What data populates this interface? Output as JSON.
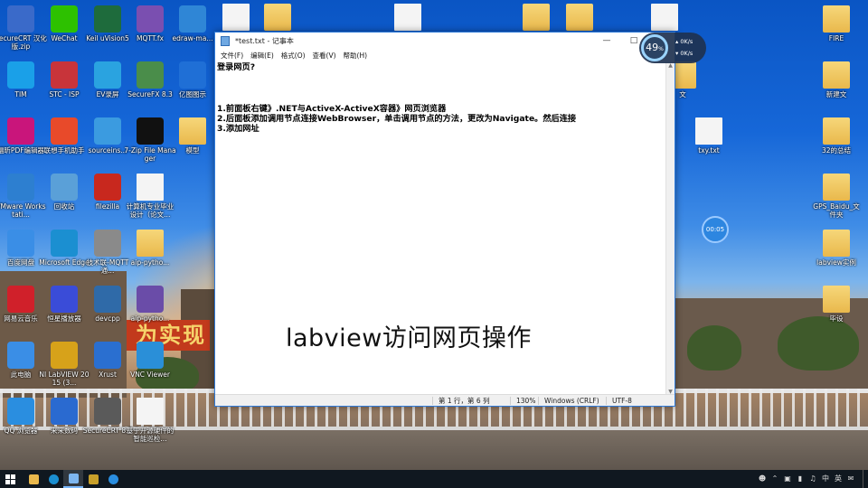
{
  "desktop": {
    "icons_left": [
      {
        "id": "securecrt-zip",
        "label": "SecureCRT 汉化版.zip",
        "icon": "winrar-archive-icon",
        "color": "#3a6ac9"
      },
      {
        "id": "wechat",
        "label": "WeChat",
        "icon": "wechat-icon",
        "color": "#2dc100"
      },
      {
        "id": "keil",
        "label": "Keil uVision5",
        "icon": "keil-icon",
        "color": "#1e6b3c"
      },
      {
        "id": "mqttfx",
        "label": "MQTT.fx",
        "icon": "mqttfx-icon",
        "color": "#7a4fb0"
      },
      {
        "id": "edraw",
        "label": "edraw-ma...",
        "icon": "edraw-icon",
        "color": "#2f86d6"
      },
      {
        "id": "tim",
        "label": "TIM",
        "icon": "tim-icon",
        "color": "#1aa0e8"
      },
      {
        "id": "stc-isp",
        "label": "STC - ISP",
        "icon": "stc-isp-icon",
        "color": "#c8343a"
      },
      {
        "id": "ev-record",
        "label": "EV录屏",
        "icon": "ev-record-icon",
        "color": "#2aa3e0"
      },
      {
        "id": "securefx",
        "label": "SecureFX 8.3",
        "icon": "securefx-icon",
        "color": "#4a8d4a"
      },
      {
        "id": "yitu",
        "label": "亿图图示",
        "icon": "yitu-icon",
        "color": "#1f6fd6"
      },
      {
        "id": "pdf-reader",
        "label": "福昕PDF编辑器",
        "icon": "pdf-icon",
        "color": "#c9157b"
      },
      {
        "id": "phone-assistant",
        "label": "联想手机助手",
        "icon": "phone-assistant-icon",
        "color": "#e84a2a"
      },
      {
        "id": "sourceinsight",
        "label": "sourceins...",
        "icon": "sourceinsight-icon",
        "color": "#3b9be0"
      },
      {
        "id": "7zip",
        "label": "7-Zip File Manager",
        "icon": "7zip-icon",
        "color": "#111111"
      },
      {
        "id": "folder-model",
        "label": "模型",
        "icon": "folder-icon",
        "color": "#e9b84c"
      },
      {
        "id": "vmware",
        "label": "VMware Workstati...",
        "icon": "vmware-icon",
        "color": "#2d7fd0"
      },
      {
        "id": "recycle-bin",
        "label": "回收站",
        "icon": "recycle-bin-icon",
        "color": "#5aa0d8"
      },
      {
        "id": "filezilla",
        "label": "filezilla",
        "icon": "filezilla-icon",
        "color": "#c8281e"
      },
      {
        "id": "doc-graduation",
        "label": "计算机专业毕业设计（论文...",
        "icon": "word-doc-icon",
        "color": "#2b5797"
      },
      {
        "id": "baidu-netdisk",
        "label": "百度网盘",
        "icon": "baidu-netdisk-icon",
        "color": "#3a8ee6"
      },
      {
        "id": "edge",
        "label": "Microsoft Edge",
        "icon": "edge-icon",
        "color": "#1b8fd1"
      },
      {
        "id": "mqtt-tool",
        "label": "技术联-MQTT通...",
        "icon": "tools-icon",
        "color": "#8a8a8a"
      },
      {
        "id": "aip-python",
        "label": "aip-pytho...",
        "icon": "folder-icon",
        "color": "#e9b84c"
      },
      {
        "id": "netease-music",
        "label": "网易云音乐",
        "icon": "netease-music-icon",
        "color": "#d0202a"
      },
      {
        "id": "video-player",
        "label": "恒星播放器",
        "icon": "video-player-icon",
        "color": "#3a4cd8"
      },
      {
        "id": "devcpp",
        "label": "devcpp",
        "icon": "devcpp-icon",
        "color": "#2f6aa8"
      },
      {
        "id": "aip-python-zip",
        "label": "aip-pytho...",
        "icon": "winrar-archive-icon",
        "color": "#6a4ca8"
      },
      {
        "id": "this-pc",
        "label": "此电脑",
        "icon": "this-pc-icon",
        "color": "#3a8ee6"
      },
      {
        "id": "labview",
        "label": "NI LabVIEW 2015 (3...",
        "icon": "labview-icon",
        "color": "#d7a21a"
      },
      {
        "id": "xrust",
        "label": "Xrust",
        "icon": "xrust-icon",
        "color": "#2a6fd0"
      },
      {
        "id": "vnc-viewer",
        "label": "VNC Viewer",
        "icon": "vnc-icon",
        "color": "#2a8fd8"
      },
      {
        "id": "qq-mail",
        "label": "QQ 浏览器",
        "icon": "qq-browser-icon",
        "color": "#2a8ee0"
      },
      {
        "id": "laiyin",
        "label": "来来数码",
        "icon": "globe-icon",
        "color": "#2a6ad0"
      },
      {
        "id": "securecrt",
        "label": "SecureCRT 8.3",
        "icon": "securecrt-icon",
        "color": "#5a5a5a"
      },
      {
        "id": "doc-fpga",
        "label": "基于开源硬件的智能巡检...",
        "icon": "word-doc-icon",
        "color": "#2b5797"
      }
    ],
    "icons_top": [
      {
        "id": "doc-top-1",
        "label": "",
        "icon": "document-icon"
      },
      {
        "id": "folder-top-2",
        "label": "",
        "icon": "folder-icon"
      },
      {
        "id": "image-top-3",
        "label": "",
        "icon": "image-file-icon"
      },
      {
        "id": "folder-top-4",
        "label": "",
        "icon": "folder-icon"
      },
      {
        "id": "folder-top-5",
        "label": "",
        "icon": "folder-icon"
      },
      {
        "id": "doc-top-6",
        "label": "",
        "icon": "document-icon"
      }
    ],
    "icons_right": [
      {
        "id": "fire",
        "label": "FIRE",
        "icon": "folder-icon"
      },
      {
        "id": "wen",
        "label": "文",
        "icon": "folder-icon"
      },
      {
        "id": "new-folder",
        "label": "新建文",
        "icon": "folder-icon"
      },
      {
        "id": "txy",
        "label": "txy.txt",
        "icon": "text-file-icon"
      },
      {
        "id": "summary",
        "label": "32的总结",
        "icon": "folder-icon"
      },
      {
        "id": "gps",
        "label": "GPS_Baidu_文件夹",
        "icon": "folder-icon"
      },
      {
        "id": "labview-demo",
        "label": "labview实例",
        "icon": "folder-icon"
      },
      {
        "id": "bisai",
        "label": "毕设",
        "icon": "folder-icon"
      }
    ],
    "banner_text": "为实现"
  },
  "notepad": {
    "title": "*test.txt - 记事本",
    "menu": [
      "文件(F)",
      "编辑(E)",
      "格式(O)",
      "查看(V)",
      "帮助(H)"
    ],
    "lines": [
      "登录网页?",
      "",
      "",
      "",
      "1.前面板右键》.NET与ActiveX-ActiveX容器》网页浏览器",
      "2.后面板添加调用节点连接WebBrowser，单击调用节点的方法，更改为Navigate。然后连接",
      "3.添加网址"
    ],
    "overlay_caption": "labview访问网页操作",
    "status": {
      "position": "第 1 行，第 6 列",
      "zoom": "130%",
      "encoding_line": "Windows (CRLF)",
      "charset": "UTF-8"
    }
  },
  "widgets": {
    "net_percent": "49",
    "net_percent_unit": "%",
    "upload": "0K/s",
    "download": "0K/s",
    "timer": "00:05"
  },
  "taskbar": {
    "apps": [
      "start-icon",
      "file-explorer-icon",
      "edge-icon",
      "notepad-icon",
      "labview-icon",
      "qq-browser-icon"
    ],
    "tray_ime": "中",
    "tray_keyboard": "英"
  }
}
